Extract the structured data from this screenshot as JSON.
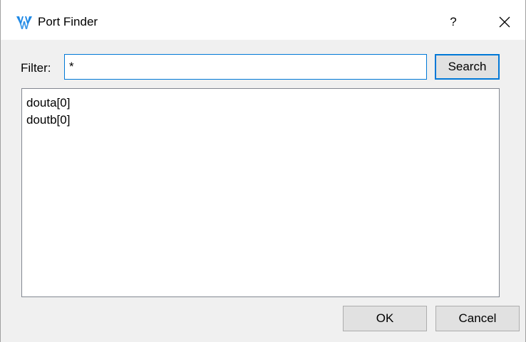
{
  "window": {
    "title": "Port Finder",
    "help_label": "?",
    "close_icon": "close-icon",
    "app_icon": "gowin-logo-icon",
    "app_icon_color": "#1e88e5"
  },
  "filter": {
    "label": "Filter:",
    "value": "*"
  },
  "search_button": {
    "label": "Search"
  },
  "ports": [
    {
      "label": "douta[0]"
    },
    {
      "label": "doutb[0]"
    }
  ],
  "footer": {
    "ok_label": "OK",
    "cancel_label": "Cancel"
  },
  "colors": {
    "focus_border": "#0078d7",
    "button_face": "#e1e1e1",
    "dialog_bg": "#f0f0f0"
  }
}
